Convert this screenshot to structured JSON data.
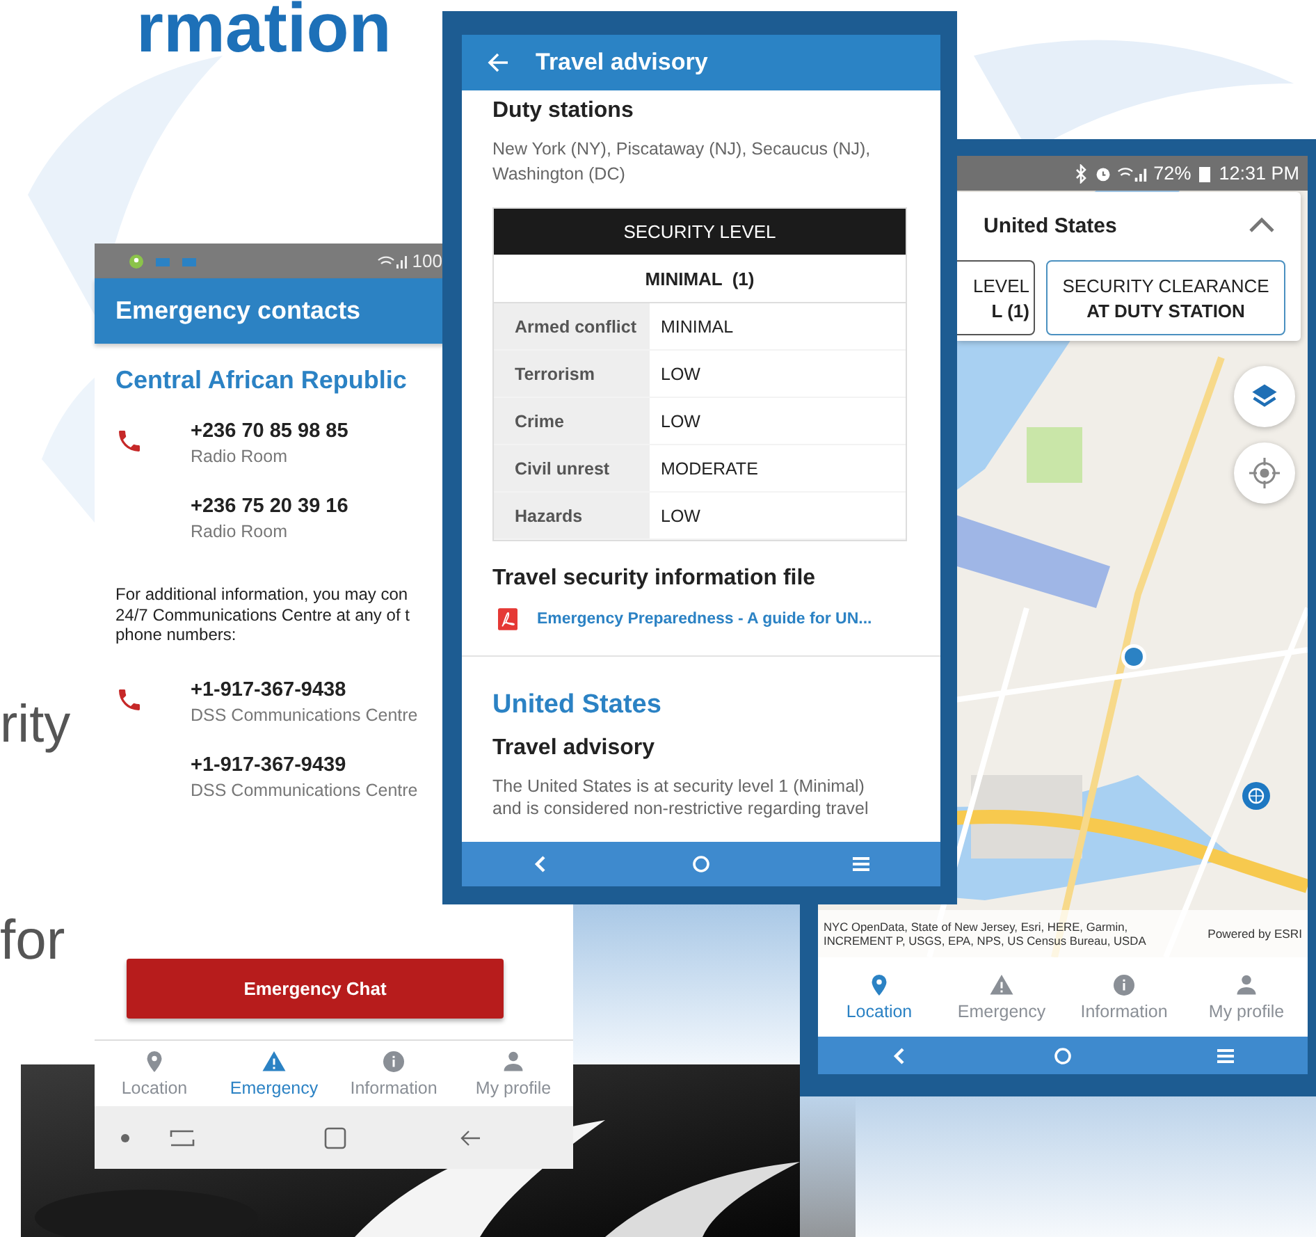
{
  "slide": {
    "title_fragment": "rmation",
    "text_fragments": [
      "rity",
      "for"
    ]
  },
  "emergency_screen": {
    "status_bar": {
      "battery": "100"
    },
    "title": "Emergency contacts",
    "country": "Central African Republic",
    "contact_groups": [
      {
        "contacts": [
          {
            "number": "+236 70 85 98 85",
            "label": "Radio Room"
          },
          {
            "number": "+236 75 20 39 16",
            "label": "Radio Room"
          }
        ]
      },
      {
        "contacts": [
          {
            "number": "+1-917-367-9438",
            "label": "DSS Communications Centre"
          },
          {
            "number": "+1-917-367-9439",
            "label": "DSS Communications Centre"
          }
        ]
      }
    ],
    "note_lines": [
      "For additional information, you may con",
      "24/7 Communications Centre at any of t",
      "phone numbers:"
    ],
    "chat_button": "Emergency Chat",
    "tabs": [
      {
        "label": "Location",
        "selected": false
      },
      {
        "label": "Emergency",
        "selected": true
      },
      {
        "label": "Information",
        "selected": false
      },
      {
        "label": "My profile",
        "selected": false
      }
    ]
  },
  "advisory_screen": {
    "title": "Travel advisory",
    "duty_stations_heading": "Duty stations",
    "duty_stations": "New York (NY), Piscataway (NJ), Secaucus (NJ), Washington (DC)",
    "table": {
      "header": "SECURITY LEVEL",
      "level": "MINIMAL  (1)",
      "rows": [
        {
          "label": "Armed conflict",
          "value": "MINIMAL"
        },
        {
          "label": "Terrorism",
          "value": "LOW"
        },
        {
          "label": "Crime",
          "value": "LOW"
        },
        {
          "label": "Civil unrest",
          "value": "MODERATE"
        },
        {
          "label": "Hazards",
          "value": "LOW"
        }
      ]
    },
    "file_heading": "Travel security information file",
    "file_link": "Emergency Preparedness - A guide for UN...",
    "country": "United States",
    "advisory_heading": "Travel advisory",
    "advisory_lines": [
      "The United States is at security level 1 (Minimal)",
      "and is considered non-restrictive regarding travel"
    ]
  },
  "map_screen": {
    "status_bar": {
      "battery": "72%",
      "time": "12:31 PM"
    },
    "card": {
      "title": "United States",
      "buttons": [
        {
          "line1": "LEVEL",
          "line2": "L (1)"
        },
        {
          "line1": "SECURITY CLEARANCE",
          "line2": "AT DUTY STATION"
        }
      ]
    },
    "attribution": "NYC OpenData, State of New Jersey, Esri, HERE, Garmin, INCREMENT P, USGS, EPA, NPS, US Census Bureau, USDA",
    "powered_by": "Powered by ESRI",
    "tabs": [
      {
        "label": "Location",
        "selected": true
      },
      {
        "label": "Emergency",
        "selected": false
      },
      {
        "label": "Information",
        "selected": false
      },
      {
        "label": "My profile",
        "selected": false
      }
    ]
  }
}
